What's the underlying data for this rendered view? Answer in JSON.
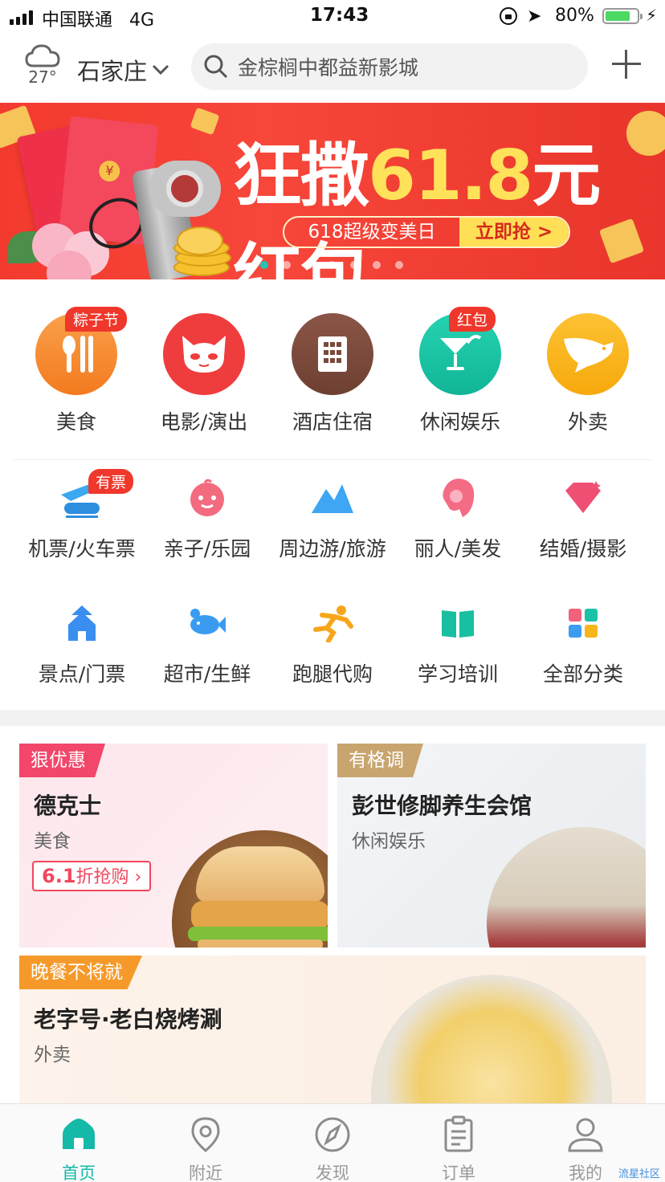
{
  "status_bar": {
    "carrier": "中国联通",
    "network": "4G",
    "time": "17:43",
    "battery_pct": "80%",
    "battery_level": 0.8
  },
  "header": {
    "weather_icon": "cloud-icon",
    "temperature": "27°",
    "city": "石家庄",
    "search_placeholder": "金棕榈中都益新影城",
    "add_icon": "plus-icon"
  },
  "banner": {
    "title_pre": "狂撒",
    "title_num": "61.8",
    "title_post": "元红包",
    "pill_left": "618超级变美日",
    "pill_right": "立即抢 >",
    "slides": 7,
    "active_slide": 0
  },
  "main_categories": [
    {
      "label": "美食",
      "tag": "粽子节",
      "icon": "fork-spoon-icon",
      "color": "#f7882f"
    },
    {
      "label": "电影/演出",
      "tag": "",
      "icon": "cat-icon",
      "color": "#ef3d3d"
    },
    {
      "label": "酒店住宿",
      "tag": "",
      "icon": "building-icon",
      "color": "#7a4a3c"
    },
    {
      "label": "休闲娱乐",
      "tag": "红包",
      "icon": "cocktail-icon",
      "color": "#16c3a1"
    },
    {
      "label": "外卖",
      "tag": "",
      "icon": "kangaroo-icon",
      "color": "#f9b41a"
    }
  ],
  "sub_categories": [
    {
      "label": "机票/火车票",
      "tag": "有票",
      "icon": "plane-train-icon"
    },
    {
      "label": "亲子/乐园",
      "tag": "",
      "icon": "baby-face-icon"
    },
    {
      "label": "周边游/旅游",
      "tag": "",
      "icon": "mountain-icon"
    },
    {
      "label": "丽人/美发",
      "tag": "",
      "icon": "woman-hair-icon"
    },
    {
      "label": "结婚/摄影",
      "tag": "",
      "icon": "diamond-icon"
    },
    {
      "label": "景点/门票",
      "tag": "",
      "icon": "temple-icon"
    },
    {
      "label": "超市/生鲜",
      "tag": "",
      "icon": "fish-icon"
    },
    {
      "label": "跑腿代购",
      "tag": "",
      "icon": "runner-icon"
    },
    {
      "label": "学习培训",
      "tag": "",
      "icon": "book-icon"
    },
    {
      "label": "全部分类",
      "tag": "",
      "icon": "grid-icon"
    }
  ],
  "cards": [
    {
      "badge": "狠优惠",
      "title": "德克士",
      "subtitle": "美食",
      "deal_num": "6.1",
      "deal_text": "折抢购 ›",
      "image": "burger-photo"
    },
    {
      "badge": "有格调",
      "title": "彭世修脚养生会馆",
      "subtitle": "休闲娱乐",
      "image": "spa-room-photo"
    },
    {
      "badge": "晚餐不将就",
      "title": "老字号·老白烧烤涮",
      "subtitle": "外卖",
      "image": "fried-rice-photo"
    }
  ],
  "tabbar": [
    {
      "label": "首页",
      "icon": "home-icon",
      "active": true
    },
    {
      "label": "附近",
      "icon": "location-pin-icon",
      "active": false
    },
    {
      "label": "发现",
      "icon": "compass-icon",
      "active": false
    },
    {
      "label": "订单",
      "icon": "clipboard-icon",
      "active": false
    },
    {
      "label": "我的",
      "icon": "user-icon",
      "active": false
    }
  ],
  "watermark": "流星社区",
  "colors": {
    "accent": "#14b9a8",
    "tag_red": "#f0372b",
    "banner_red": "#f3402f"
  }
}
